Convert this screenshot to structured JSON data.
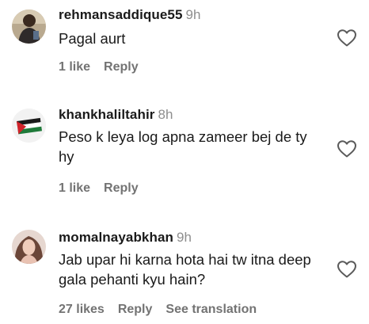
{
  "comments": [
    {
      "username": "rehmansaddique55",
      "time": "9h",
      "text": "Pagal aurt",
      "likes": "1 like",
      "reply": "Reply"
    },
    {
      "username": "khankhaliltahir",
      "time": "8h",
      "text": "Peso k leya log apna zameer bej de ty hy",
      "likes": "1 like",
      "reply": "Reply"
    },
    {
      "username": "momalnayabkhan",
      "time": "9h",
      "text": "Jab upar hi karna hota hai tw itna deep gala pehanti kyu hain?",
      "likes": "27 likes",
      "reply": "Reply",
      "translation": "See translation"
    }
  ],
  "icons": {
    "like": "heart-outline-icon",
    "avatar_flag": "palestine-flag-icon"
  },
  "colors": {
    "muted": "#8e8e8e",
    "action": "#737373",
    "text": "#1a1a1a"
  }
}
